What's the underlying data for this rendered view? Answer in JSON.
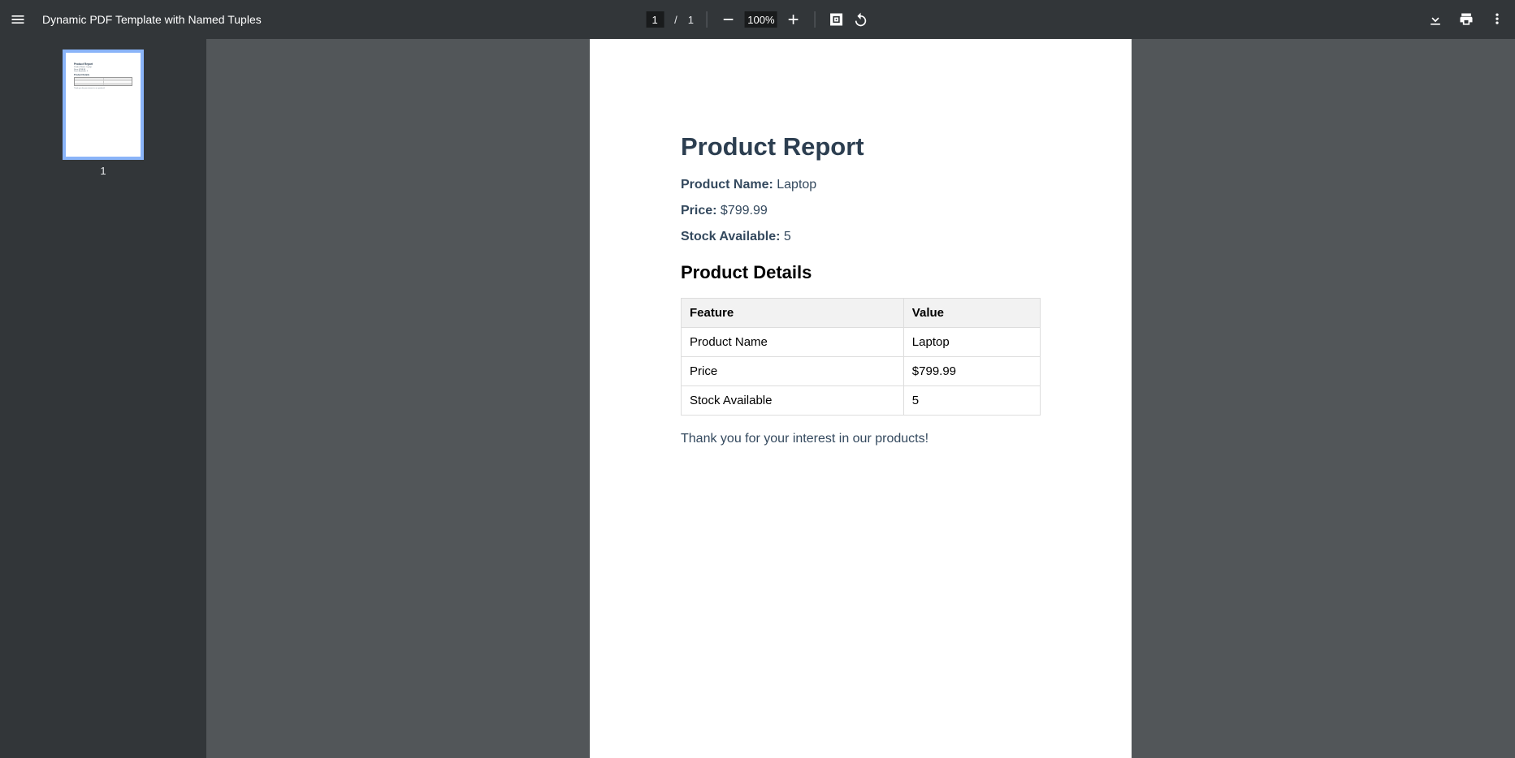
{
  "toolbar": {
    "doc_title": "Dynamic PDF Template with Named Tuples",
    "page_current": "1",
    "page_total": "1",
    "zoom": "100%"
  },
  "sidebar": {
    "thumb_page_number": "1"
  },
  "report": {
    "title": "Product Report",
    "fields": {
      "product_name_label": "Product Name:",
      "product_name_value": "Laptop",
      "price_label": "Price:",
      "price_value": "$799.99",
      "stock_label": "Stock Available:",
      "stock_value": "5"
    },
    "details_heading": "Product Details",
    "table": {
      "headers": {
        "feature": "Feature",
        "value": "Value"
      },
      "rows": [
        {
          "feature": "Product Name",
          "value": "Laptop"
        },
        {
          "feature": "Price",
          "value": "$799.99"
        },
        {
          "feature": "Stock Available",
          "value": "5"
        }
      ]
    },
    "footer": "Thank you for your interest in our products!"
  }
}
